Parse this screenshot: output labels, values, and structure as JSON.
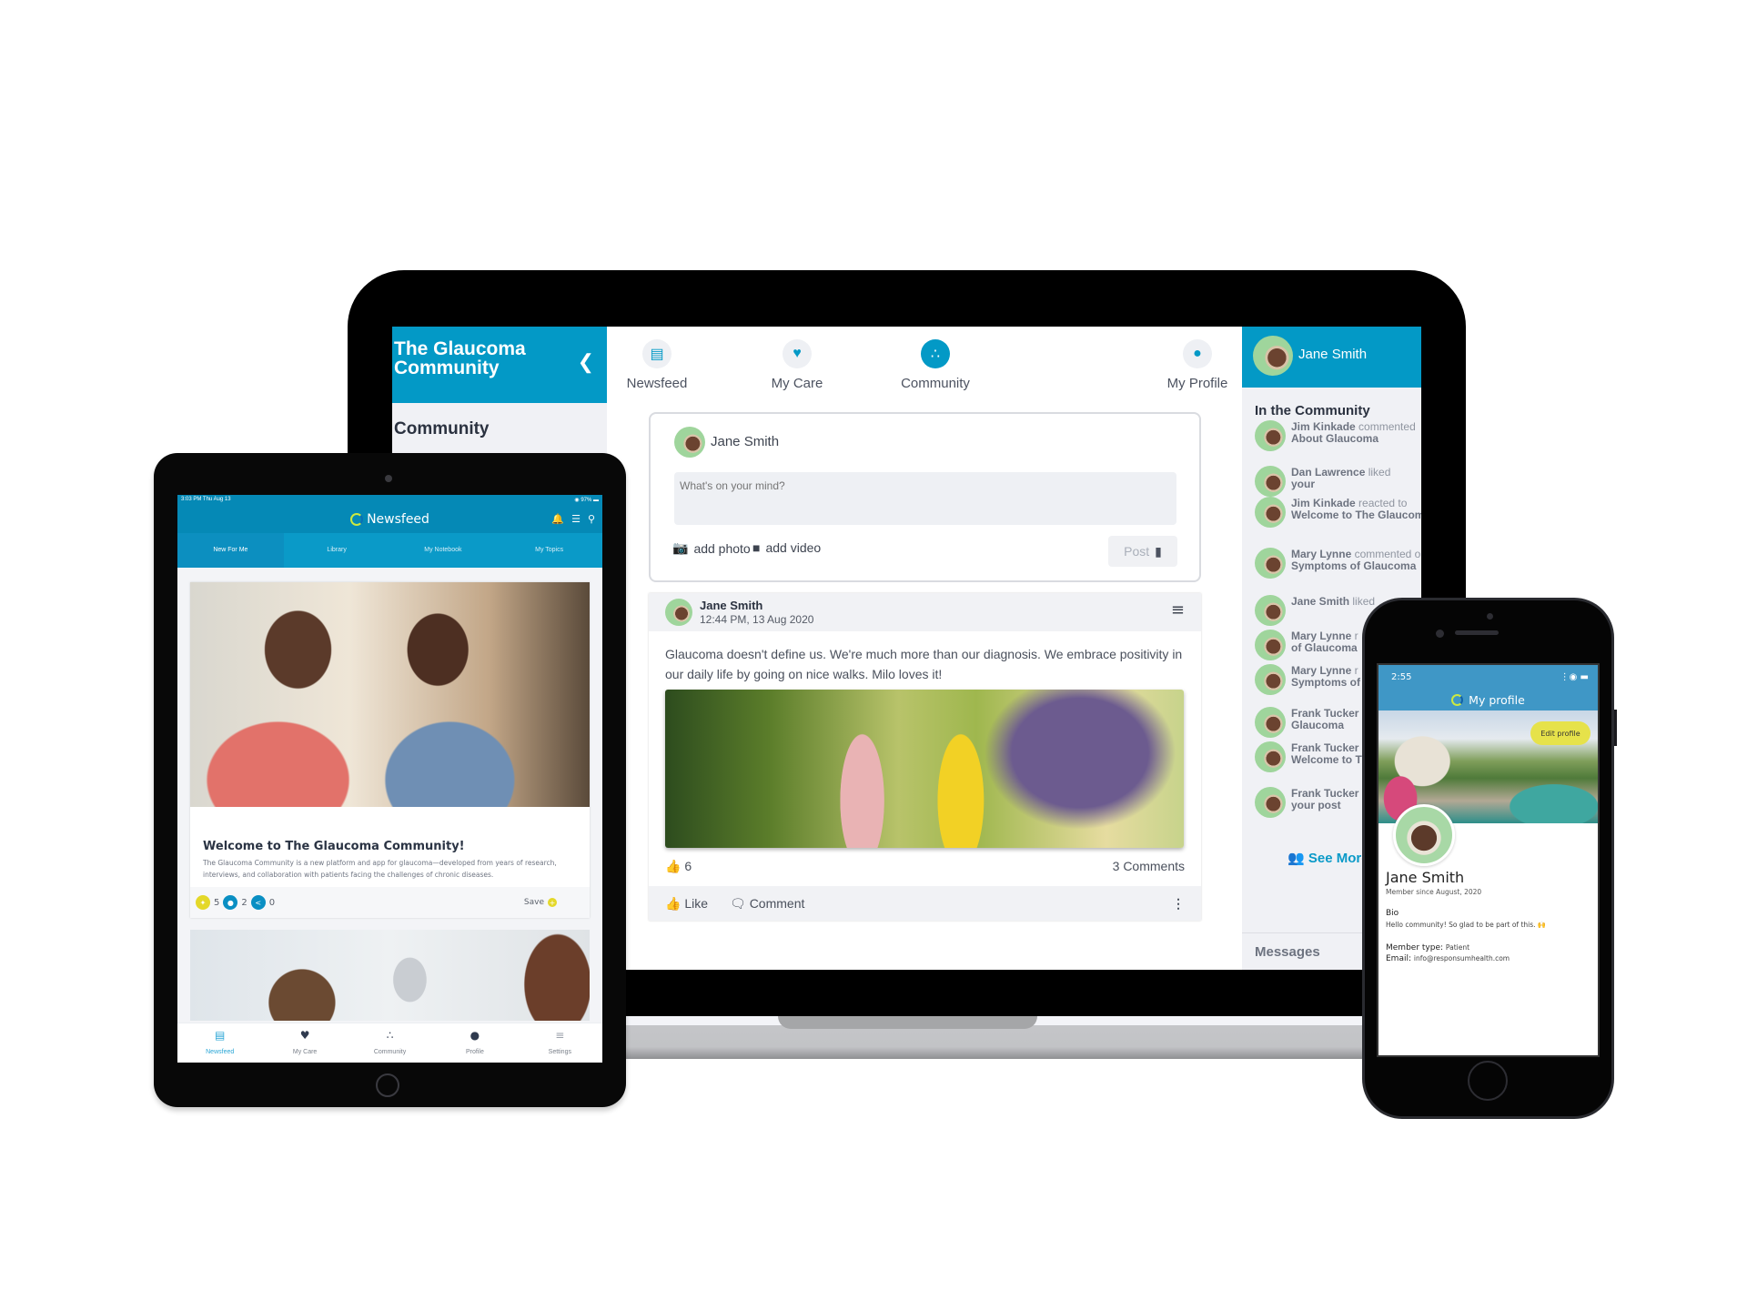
{
  "laptop": {
    "sidebar": {
      "title": "The Glaucoma Community",
      "collapse_icon": "chevron-left-icon",
      "section": "Community"
    },
    "nav": [
      {
        "label": "Newsfeed",
        "icon": "newspaper-icon",
        "active": false
      },
      {
        "label": "My Care",
        "icon": "heart-icon",
        "active": false
      },
      {
        "label": "Community",
        "icon": "community-icon",
        "active": true
      },
      {
        "label": "My Profile",
        "icon": "user-icon",
        "active": false
      }
    ],
    "composer": {
      "user": "Jane Smith",
      "placeholder": "What's on your mind?",
      "add_photo": "add photo",
      "add_video": "add video",
      "post_label": "Post"
    },
    "post": {
      "author": "Jane Smith",
      "time": "12:44 PM, 13 Aug 2020",
      "text": "Glaucoma doesn't define us. We're much more than our diagnosis. We embrace positivity in our daily life by going on nice walks. Milo loves it!",
      "likes": "6",
      "comments": "3 Comments",
      "like_label": "Like",
      "comment_label": "Comment"
    },
    "right_panel": {
      "user": "Jane Smith",
      "section_title": "In the Community",
      "activity": [
        {
          "name": "Jim Kinkade",
          "action": "commented",
          "target": "About Glaucoma"
        },
        {
          "name": "Dan Lawrence",
          "action": "liked",
          "target": "your"
        },
        {
          "name": "Jim Kinkade",
          "action": "reacted to",
          "target": "Welcome to The Glaucoma Community!"
        },
        {
          "name": "Mary Lynne",
          "action": "commented on",
          "target": "Symptoms of Glaucoma"
        },
        {
          "name": "Jane Smith",
          "action": "liked",
          "target": ""
        },
        {
          "name": "Mary Lynne",
          "action": "r",
          "target": "of Glaucoma"
        },
        {
          "name": "Mary Lynne",
          "action": "r",
          "target": "Symptoms of"
        },
        {
          "name": "Frank Tucker",
          "action": "",
          "target": "Glaucoma"
        },
        {
          "name": "Frank Tucker",
          "action": "",
          "target": "Welcome to The Community!"
        },
        {
          "name": "Frank Tucker",
          "action": "",
          "target": "your post"
        }
      ],
      "see_more": "See More",
      "messages": "Messages"
    }
  },
  "tablet": {
    "status_time": "3:03 PM  Thu Aug 13",
    "status_battery": "97%",
    "title": "Newsfeed",
    "tabs": [
      {
        "label": "New For Me",
        "active": true
      },
      {
        "label": "Library",
        "active": false
      },
      {
        "label": "My Notebook",
        "active": false
      },
      {
        "label": "My Topics",
        "active": false
      }
    ],
    "card": {
      "title": "Welcome to The Glaucoma Community!",
      "body": "The Glaucoma Community is a new platform and app for glaucoma—developed from years of research, interviews, and collaboration with patients facing the challenges of chronic diseases.",
      "reactions": "5",
      "comments": "2",
      "shares": "0",
      "save_label": "Save"
    },
    "bottom_nav": [
      {
        "label": "Newsfeed",
        "icon": "newspaper-icon",
        "active": true
      },
      {
        "label": "My Care",
        "icon": "heart-icon",
        "active": false
      },
      {
        "label": "Community",
        "icon": "community-icon",
        "active": false
      },
      {
        "label": "Profile",
        "icon": "user-icon",
        "active": false
      },
      {
        "label": "Settings",
        "icon": "menu-icon",
        "active": false
      }
    ]
  },
  "phone": {
    "status_time": "2:55",
    "title": "My profile",
    "edit_label": "Edit profile",
    "name": "Jane Smith",
    "member_since": "Member since August, 2020",
    "bio_label": "Bio",
    "bio": "Hello community! So glad to be part of this. 🙌",
    "member_type_label": "Member type:",
    "member_type": "Patient",
    "email_label": "Email:",
    "email": "info@responsumhealth.com"
  },
  "colors": {
    "brand_blue": "#0399c6",
    "phone_header": "#3f97c6",
    "accent_yellow": "#e6e24a"
  }
}
